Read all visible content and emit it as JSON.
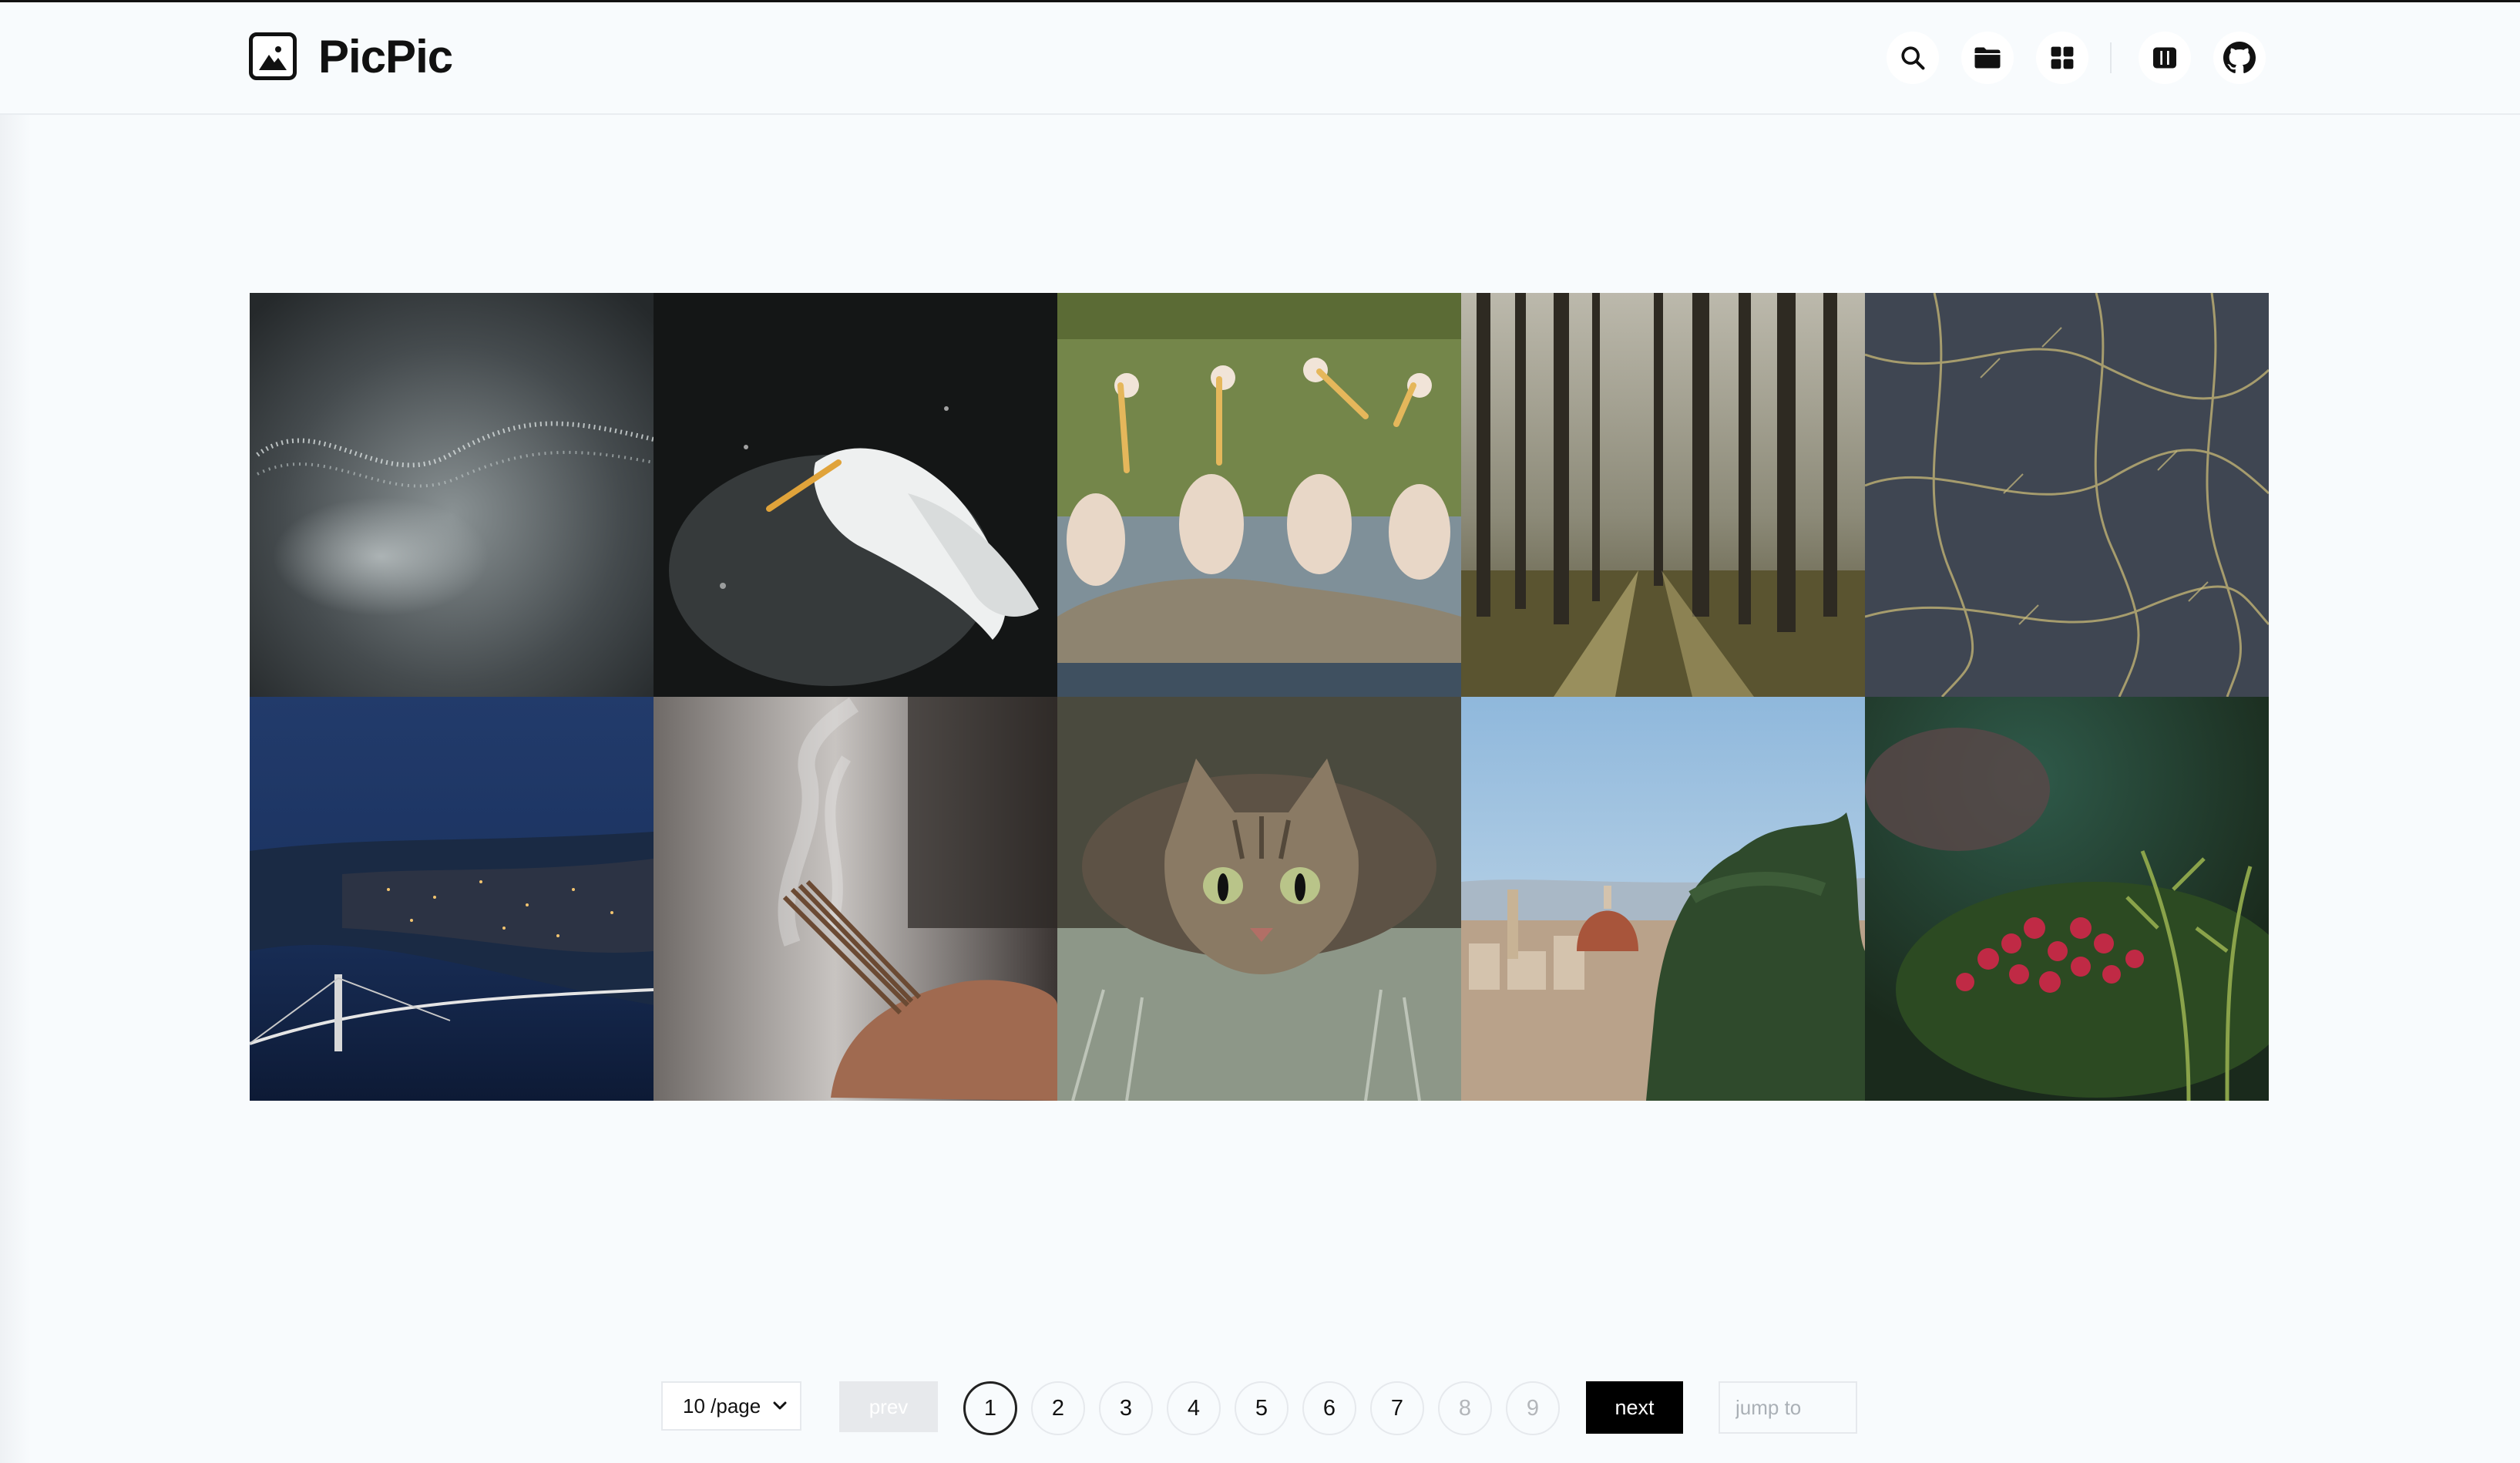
{
  "app": {
    "title": "PicPic"
  },
  "nav": {
    "icons": [
      "search-icon",
      "folder-icon",
      "grid-icon",
      "columns-icon",
      "github-icon"
    ]
  },
  "gallery": {
    "images": [
      "particle-wave-photo",
      "pelican-splash-photo",
      "pelicans-on-rock-photo",
      "sunlit-forest-photo",
      "branch-pattern-photo",
      "city-bridge-night-photo",
      "incense-hand-photo",
      "tabby-cat-grass-photo",
      "florence-duomo-photo",
      "red-berries-photo"
    ]
  },
  "pagination": {
    "page_size_label": "10 /page",
    "prev_label": "prev",
    "next_label": "next",
    "pages": [
      "1",
      "2",
      "3",
      "4",
      "5",
      "6",
      "7",
      "8",
      "9"
    ],
    "current_page": "1",
    "disabled_pages": [
      "8",
      "9"
    ],
    "jump_placeholder": "jump to"
  },
  "colors": {
    "accent": "#000000",
    "background": "#f8fbfd"
  }
}
